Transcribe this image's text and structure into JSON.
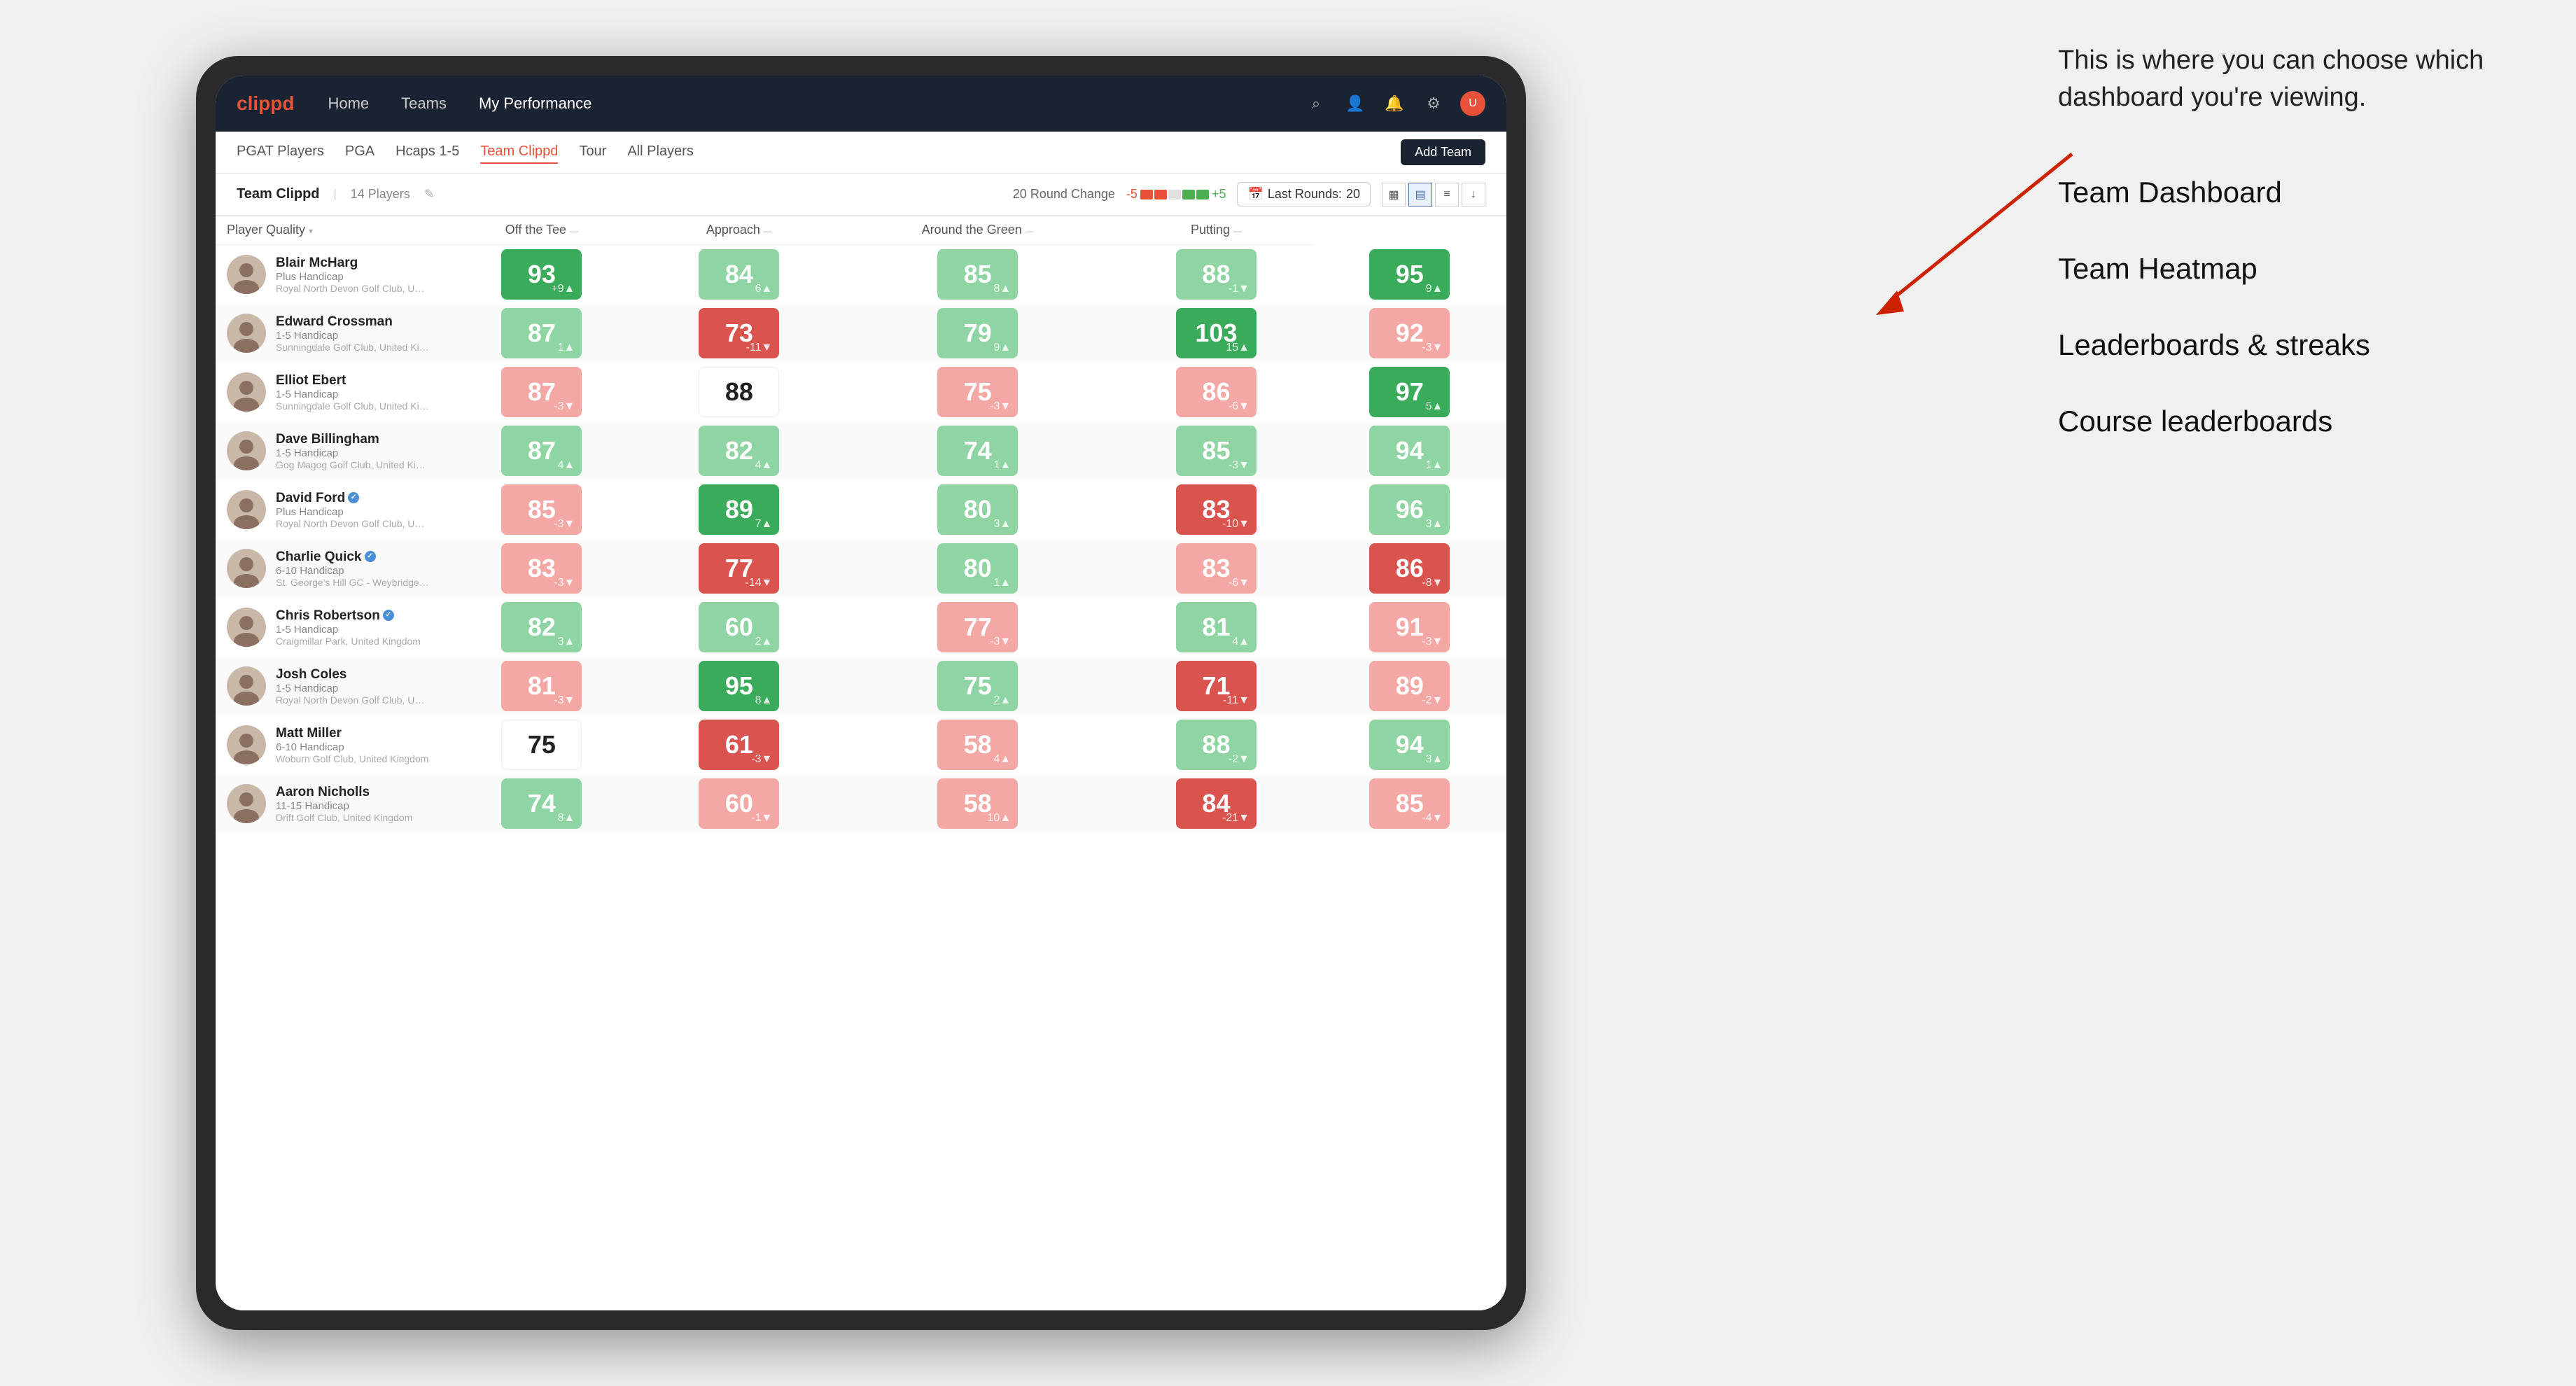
{
  "annotation": {
    "intro": "This is where you can choose which dashboard you're viewing.",
    "options": [
      "Team Dashboard",
      "Team Heatmap",
      "Leaderboards & streaks",
      "Course leaderboards"
    ]
  },
  "nav": {
    "logo": "clippd",
    "links": [
      "Home",
      "Teams",
      "My Performance"
    ],
    "active_link": "My Performance"
  },
  "sub_nav": {
    "links": [
      "PGAT Players",
      "PGA",
      "Hcaps 1-5",
      "Team Clippd",
      "Tour",
      "All Players"
    ],
    "active_link": "Team Clippd",
    "add_team_label": "Add Team"
  },
  "team_header": {
    "name": "Team Clippd",
    "separator": "|",
    "player_count": "14 Players",
    "round_change_label": "20 Round Change",
    "score_neg": "-5",
    "score_pos": "+5",
    "last_rounds_label": "Last Rounds:",
    "last_rounds_value": "20"
  },
  "table": {
    "columns": [
      {
        "key": "player",
        "label": "Player Quality",
        "sortable": true
      },
      {
        "key": "off_tee",
        "label": "Off the Tee",
        "sortable": true
      },
      {
        "key": "approach",
        "label": "Approach",
        "sortable": true
      },
      {
        "key": "around_green",
        "label": "Around the Green",
        "sortable": true
      },
      {
        "key": "putting",
        "label": "Putting",
        "sortable": true
      }
    ],
    "rows": [
      {
        "name": "Blair McHarg",
        "handicap": "Plus Handicap",
        "club": "Royal North Devon Golf Club, United Kingdom",
        "verified": false,
        "scores": [
          {
            "value": 93,
            "change": "+9▲",
            "color": "green-dark"
          },
          {
            "value": 84,
            "change": "6▲",
            "color": "green-light"
          },
          {
            "value": 85,
            "change": "8▲",
            "color": "green-light"
          },
          {
            "value": 88,
            "change": "-1▼",
            "color": "green-light"
          },
          {
            "value": 95,
            "change": "9▲",
            "color": "green-dark"
          }
        ]
      },
      {
        "name": "Edward Crossman",
        "handicap": "1-5 Handicap",
        "club": "Sunningdale Golf Club, United Kingdom",
        "verified": false,
        "scores": [
          {
            "value": 87,
            "change": "1▲",
            "color": "green-light"
          },
          {
            "value": 73,
            "change": "-11▼",
            "color": "red-dark"
          },
          {
            "value": 79,
            "change": "9▲",
            "color": "green-light"
          },
          {
            "value": 103,
            "change": "15▲",
            "color": "green-dark"
          },
          {
            "value": 92,
            "change": "-3▼",
            "color": "red-light"
          }
        ]
      },
      {
        "name": "Elliot Ebert",
        "handicap": "1-5 Handicap",
        "club": "Sunningdale Golf Club, United Kingdom",
        "verified": false,
        "scores": [
          {
            "value": 87,
            "change": "-3▼",
            "color": "red-light"
          },
          {
            "value": 88,
            "change": "",
            "color": "white"
          },
          {
            "value": 75,
            "change": "-3▼",
            "color": "red-light"
          },
          {
            "value": 86,
            "change": "-6▼",
            "color": "red-light"
          },
          {
            "value": 97,
            "change": "5▲",
            "color": "green-dark"
          }
        ]
      },
      {
        "name": "Dave Billingham",
        "handicap": "1-5 Handicap",
        "club": "Gog Magog Golf Club, United Kingdom",
        "verified": false,
        "scores": [
          {
            "value": 87,
            "change": "4▲",
            "color": "green-light"
          },
          {
            "value": 82,
            "change": "4▲",
            "color": "green-light"
          },
          {
            "value": 74,
            "change": "1▲",
            "color": "green-light"
          },
          {
            "value": 85,
            "change": "-3▼",
            "color": "green-light"
          },
          {
            "value": 94,
            "change": "1▲",
            "color": "green-light"
          }
        ]
      },
      {
        "name": "David Ford",
        "handicap": "Plus Handicap",
        "club": "Royal North Devon Golf Club, United Kingdom",
        "verified": true,
        "scores": [
          {
            "value": 85,
            "change": "-3▼",
            "color": "red-light"
          },
          {
            "value": 89,
            "change": "7▲",
            "color": "green-dark"
          },
          {
            "value": 80,
            "change": "3▲",
            "color": "green-light"
          },
          {
            "value": 83,
            "change": "-10▼",
            "color": "red-dark"
          },
          {
            "value": 96,
            "change": "3▲",
            "color": "green-light"
          }
        ]
      },
      {
        "name": "Charlie Quick",
        "handicap": "6-10 Handicap",
        "club": "St. George's Hill GC - Weybridge, Surrey, Uni...",
        "verified": true,
        "scores": [
          {
            "value": 83,
            "change": "-3▼",
            "color": "red-light"
          },
          {
            "value": 77,
            "change": "-14▼",
            "color": "red-dark"
          },
          {
            "value": 80,
            "change": "1▲",
            "color": "green-light"
          },
          {
            "value": 83,
            "change": "-6▼",
            "color": "red-light"
          },
          {
            "value": 86,
            "change": "-8▼",
            "color": "red-dark"
          }
        ]
      },
      {
        "name": "Chris Robertson",
        "handicap": "1-5 Handicap",
        "club": "Craigmillar Park, United Kingdom",
        "verified": true,
        "scores": [
          {
            "value": 82,
            "change": "3▲",
            "color": "green-light"
          },
          {
            "value": 60,
            "change": "2▲",
            "color": "green-light"
          },
          {
            "value": 77,
            "change": "-3▼",
            "color": "red-light"
          },
          {
            "value": 81,
            "change": "4▲",
            "color": "green-light"
          },
          {
            "value": 91,
            "change": "-3▼",
            "color": "red-light"
          }
        ]
      },
      {
        "name": "Josh Coles",
        "handicap": "1-5 Handicap",
        "club": "Royal North Devon Golf Club, United Kingdom",
        "verified": false,
        "scores": [
          {
            "value": 81,
            "change": "-3▼",
            "color": "red-light"
          },
          {
            "value": 95,
            "change": "8▲",
            "color": "green-dark"
          },
          {
            "value": 75,
            "change": "2▲",
            "color": "green-light"
          },
          {
            "value": 71,
            "change": "-11▼",
            "color": "red-dark"
          },
          {
            "value": 89,
            "change": "-2▼",
            "color": "red-light"
          }
        ]
      },
      {
        "name": "Matt Miller",
        "handicap": "6-10 Handicap",
        "club": "Woburn Golf Club, United Kingdom",
        "verified": false,
        "scores": [
          {
            "value": 75,
            "change": "",
            "color": "white"
          },
          {
            "value": 61,
            "change": "-3▼",
            "color": "red-dark"
          },
          {
            "value": 58,
            "change": "4▲",
            "color": "red-light"
          },
          {
            "value": 88,
            "change": "-2▼",
            "color": "green-light"
          },
          {
            "value": 94,
            "change": "3▲",
            "color": "green-light"
          }
        ]
      },
      {
        "name": "Aaron Nicholls",
        "handicap": "11-15 Handicap",
        "club": "Drift Golf Club, United Kingdom",
        "verified": false,
        "scores": [
          {
            "value": 74,
            "change": "8▲",
            "color": "green-light"
          },
          {
            "value": 60,
            "change": "-1▼",
            "color": "red-light"
          },
          {
            "value": 58,
            "change": "10▲",
            "color": "red-light"
          },
          {
            "value": 84,
            "change": "-21▼",
            "color": "red-dark"
          },
          {
            "value": 85,
            "change": "-4▼",
            "color": "red-light"
          }
        ]
      }
    ]
  }
}
